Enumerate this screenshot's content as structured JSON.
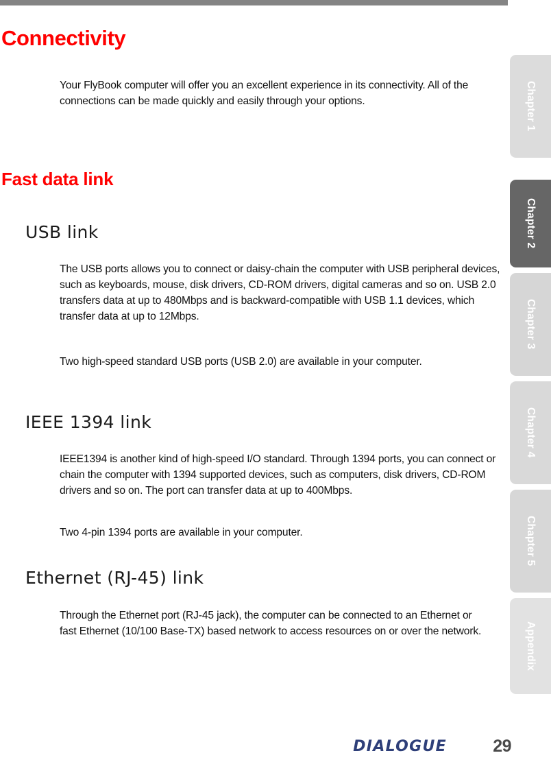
{
  "document": {
    "page_number": "29",
    "brand_logo": "DIALOGUE",
    "accent_color": "#ff0000",
    "logo_color": "#2e3f79",
    "top_rule_color": "#848484"
  },
  "content": {
    "chapter_title": "Connectivity",
    "intro_paragraph": "Your FlyBook computer will offer you an excellent experience in its connectivity. All of the connections can be made quickly and easily through your options.",
    "section_fast_data_link": "Fast data link",
    "subsections": {
      "usb": {
        "heading": "USB link",
        "paragraph_1": "The USB ports allows you to connect or daisy-chain the computer with USB peripheral devices, such as keyboards, mouse, disk drivers, CD-ROM drivers, digital cameras and so on. USB 2.0 transfers data at up to 480Mbps and is backward-compatible with USB 1.1 devices, which transfer data at up to 12Mbps.",
        "paragraph_2": "Two high-speed standard USB ports (USB 2.0) are available in your computer."
      },
      "ieee1394": {
        "heading": "IEEE 1394 link",
        "paragraph_1": "IEEE1394 is another kind of high-speed I/O standard. Through 1394 ports, you can connect or chain the computer with 1394 supported devices, such as computers, disk drivers, CD-ROM drivers and so on. The port can transfer data at up to 400Mbps.",
        "paragraph_2": "Two 4-pin 1394 ports are available in your computer."
      },
      "ethernet": {
        "heading": "Ethernet (RJ-45) link",
        "paragraph_1": "Through the Ethernet port (RJ-45 jack), the computer can be connected to an Ethernet or fast Ethernet (10/100 Base-TX) based network to access resources on or over the network."
      }
    }
  },
  "tab_rail": {
    "tabs": [
      {
        "label": "Chapter 1",
        "active": false
      },
      {
        "label": "Chapter 2",
        "active": true
      },
      {
        "label": "Chapter 3",
        "active": false
      },
      {
        "label": "Chapter 4",
        "active": false
      },
      {
        "label": "Chapter 5",
        "active": false
      },
      {
        "label": "Appendix",
        "active": false
      }
    ]
  }
}
